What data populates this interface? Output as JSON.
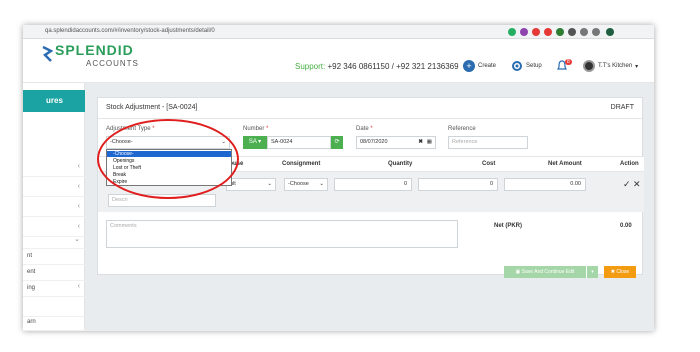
{
  "browser": {
    "url": "qa.splendidaccounts.com/#/inventory/stock-adjustments/detail/0"
  },
  "app": {
    "logo_main": "SPLENDID",
    "logo_sub": "ACCOUNTS",
    "support_label": "Support:",
    "support_phones": "+92 346 0861150 / +92 321 2136369",
    "create_label": "Create",
    "setup_label": "Setup",
    "notif_count": "8",
    "user_name": "T.T's Kitchen"
  },
  "sidebar": {
    "header": "ures",
    "items": [
      {
        "label": "",
        "chev": "‹"
      },
      {
        "label": "",
        "chev": "‹"
      },
      {
        "label": "",
        "chev": "‹"
      },
      {
        "label": "",
        "chev": "‹"
      },
      {
        "label": "",
        "chev": "⌄"
      },
      {
        "label": "nt",
        "chev": ""
      },
      {
        "label": "ent",
        "chev": ""
      },
      {
        "label": "ing",
        "chev": "‹"
      },
      {
        "label": "",
        "chev": ""
      },
      {
        "label": "arn",
        "chev": ""
      }
    ]
  },
  "form": {
    "title": "Stock Adjustment - [SA-0024]",
    "status": "DRAFT",
    "adjustment_type_label": "Adjustment Type",
    "adjustment_type_value": "-Choose-",
    "number_label": "Number",
    "number_prefix": "SA ▾",
    "number_value": "SA-0024",
    "date_label": "Date",
    "date_value": "08/07/2020",
    "reference_label": "Reference",
    "reference_placeholder": "Reference",
    "required_mark": "*"
  },
  "table": {
    "headers": [
      "rehouse",
      "Consignment",
      "Quantity",
      "Cost",
      "Net Amount",
      "Action"
    ],
    "row": {
      "warehouse": "ult",
      "consignment": "-Choose",
      "quantity": "0",
      "cost": "0",
      "net_amount": "0.00",
      "description_placeholder": "Descri"
    }
  },
  "comments_placeholder": "Comments",
  "net_label": "Net (PKR)",
  "net_value": "0.00",
  "buttons": {
    "save": "Save And Continue Edit",
    "close": "Close"
  },
  "dropdown": {
    "options": [
      "-Choose-",
      "Openings",
      "Lost or Theft",
      "Break",
      "Expire"
    ],
    "selected_index": 0
  },
  "colors": {
    "brand_green": "#2a9d5a",
    "sidebar_teal": "#1ba3a3",
    "annotation_red": "#e01e1e",
    "close_orange": "#f39c12",
    "dropdown_highlight": "#1e66d0"
  }
}
